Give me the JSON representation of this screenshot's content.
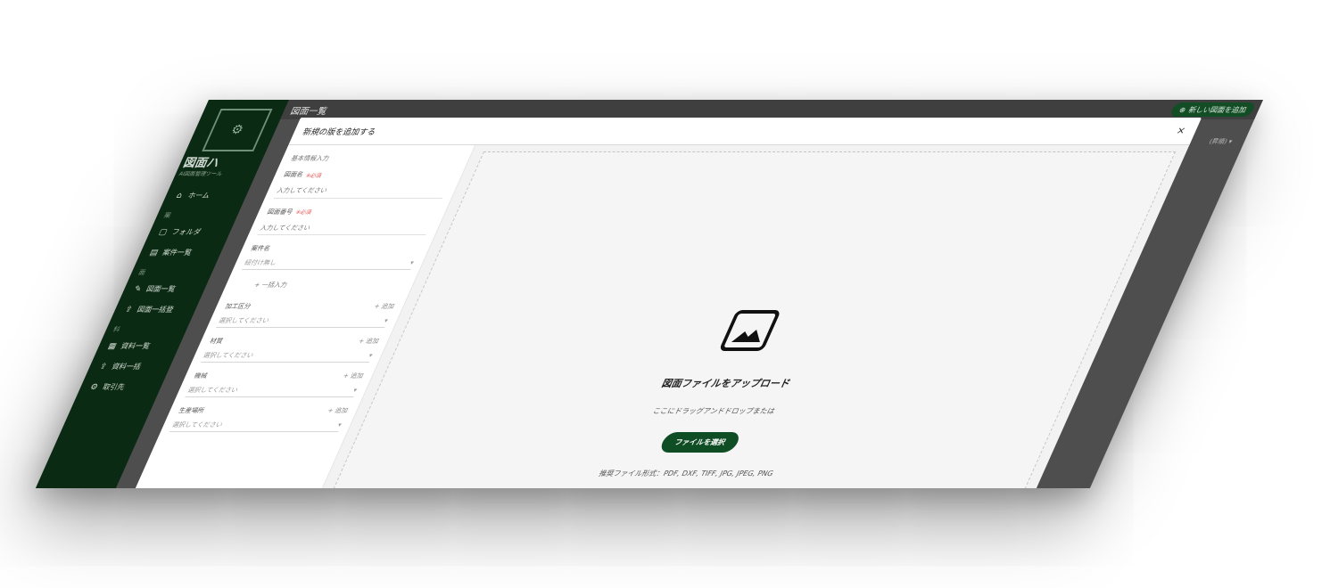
{
  "app": {
    "brand": "図面ハ",
    "brand_sub": "AI図面管理ツール",
    "header_title": "図面一覧",
    "new_button": "新しい図面を追加",
    "sort_label": "(昇順)"
  },
  "sidebar": {
    "items": [
      {
        "type": "item",
        "label": "ホーム",
        "icon": "home-icon"
      },
      {
        "type": "section",
        "label": "案"
      },
      {
        "type": "item",
        "label": "フォルダ",
        "icon": "folder-icon"
      },
      {
        "type": "item",
        "label": "案件一覧",
        "icon": "list-icon"
      },
      {
        "type": "section",
        "label": "面"
      },
      {
        "type": "item",
        "label": "図面一覧",
        "icon": "drawing-icon"
      },
      {
        "type": "item",
        "label": "図面一括登",
        "icon": "upload-icon"
      },
      {
        "type": "section",
        "label": "料"
      },
      {
        "type": "item",
        "label": "資料一覧",
        "icon": "doc-icon"
      },
      {
        "type": "item",
        "label": "資料一括",
        "icon": "upload-icon"
      },
      {
        "type": "item",
        "label": "取引先",
        "icon": "partner-icon"
      }
    ]
  },
  "modal": {
    "title": "新規の版を追加する",
    "close": "×",
    "form": {
      "section_title": "基本情報入力",
      "drawing_name_label": "図面名",
      "drawing_name_required": "※必須",
      "drawing_name_placeholder": "入力してください",
      "drawing_number_label": "図面番号",
      "drawing_number_required": "※必須",
      "drawing_number_placeholder": "入力してください",
      "project_label": "案件名",
      "project_value": "紐付け無し",
      "batch_link": "一括入力",
      "process_label": "加工区分",
      "process_add": "追加",
      "process_value": "選択してください",
      "material_label": "材質",
      "material_add": "追加",
      "material_value": "選択してください",
      "machine_label": "機械",
      "machine_add": "追加",
      "machine_value": "選択してください",
      "location_label": "生産場所",
      "location_add": "追加",
      "location_value": "選択してください"
    },
    "upload": {
      "icon": "image-icon",
      "title": "図面ファイルをアップロード",
      "subtitle": "ここにドラッグアンドドロップまたは",
      "button": "ファイルを選択",
      "formats": "推奨ファイル形式：PDF, DXF, TIFF, JPG, JPEG, PNG"
    }
  },
  "colors": {
    "sidebar": "#0b2a13",
    "accent": "#0f4d24",
    "overlay": "#4e4e4e"
  }
}
